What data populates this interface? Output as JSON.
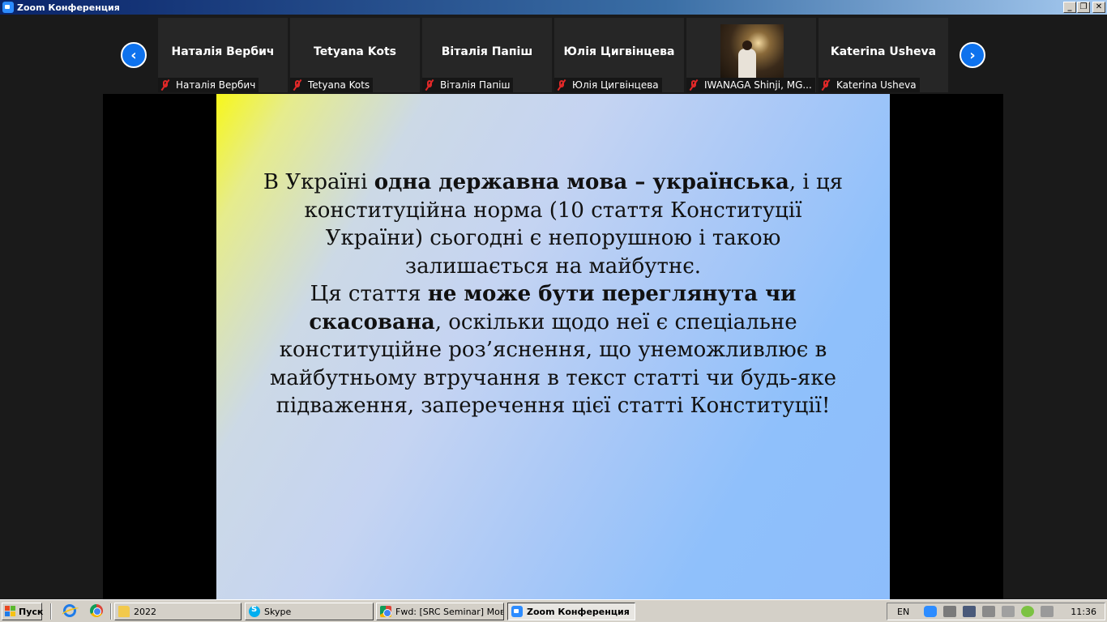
{
  "window": {
    "title": "Zoom Конференция",
    "min_label": "_",
    "max_label": "❐",
    "close_label": "✕"
  },
  "gallery": {
    "prev_label": "‹",
    "next_label": "›",
    "tiles": [
      {
        "name": "Наталія Вербич",
        "label": "Наталія Вербич"
      },
      {
        "name": "Tetyana Kots",
        "label": "Tetyana Kots"
      },
      {
        "name": "Віталія Папіш",
        "label": "Віталія Папіш"
      },
      {
        "name": "Юлія Цигвінцева",
        "label": "Юлія Цигвінцева"
      },
      {
        "name": "",
        "label": "IWANAGA Shinji, MG..."
      },
      {
        "name": "Katerina Usheva",
        "label": "Katerina Usheva"
      }
    ]
  },
  "slide": {
    "p1_a": "В Україні ",
    "p1_b": "одна державна мова – українська",
    "p1_c": ", і ця конституційна норма (10 стаття Конституції України) сьогодні є непорушною і такою залишається на майбутнє.",
    "p2_a": "Ця стаття ",
    "p2_b": "не може бути переглянута чи скасована",
    "p2_c": ", оскільки щодо неї є спеціальне конституційне роз’яснення, що унеможливлює в майбутньому втручання в текст статті чи будь-яке підваження, заперечення цієї статті Конституції!"
  },
  "taskbar": {
    "start_label": "Пуск",
    "tasks": [
      {
        "label": "2022",
        "icon": "folder-icon"
      },
      {
        "label": "Skype",
        "icon": "skype-icon"
      },
      {
        "label": "Fwd: [SRC Seminar] Мов...",
        "icon": "chrome-icon"
      },
      {
        "label": "Zoom Конференция",
        "icon": "zoom-icon"
      }
    ],
    "language": "EN",
    "clock": "11:36"
  }
}
